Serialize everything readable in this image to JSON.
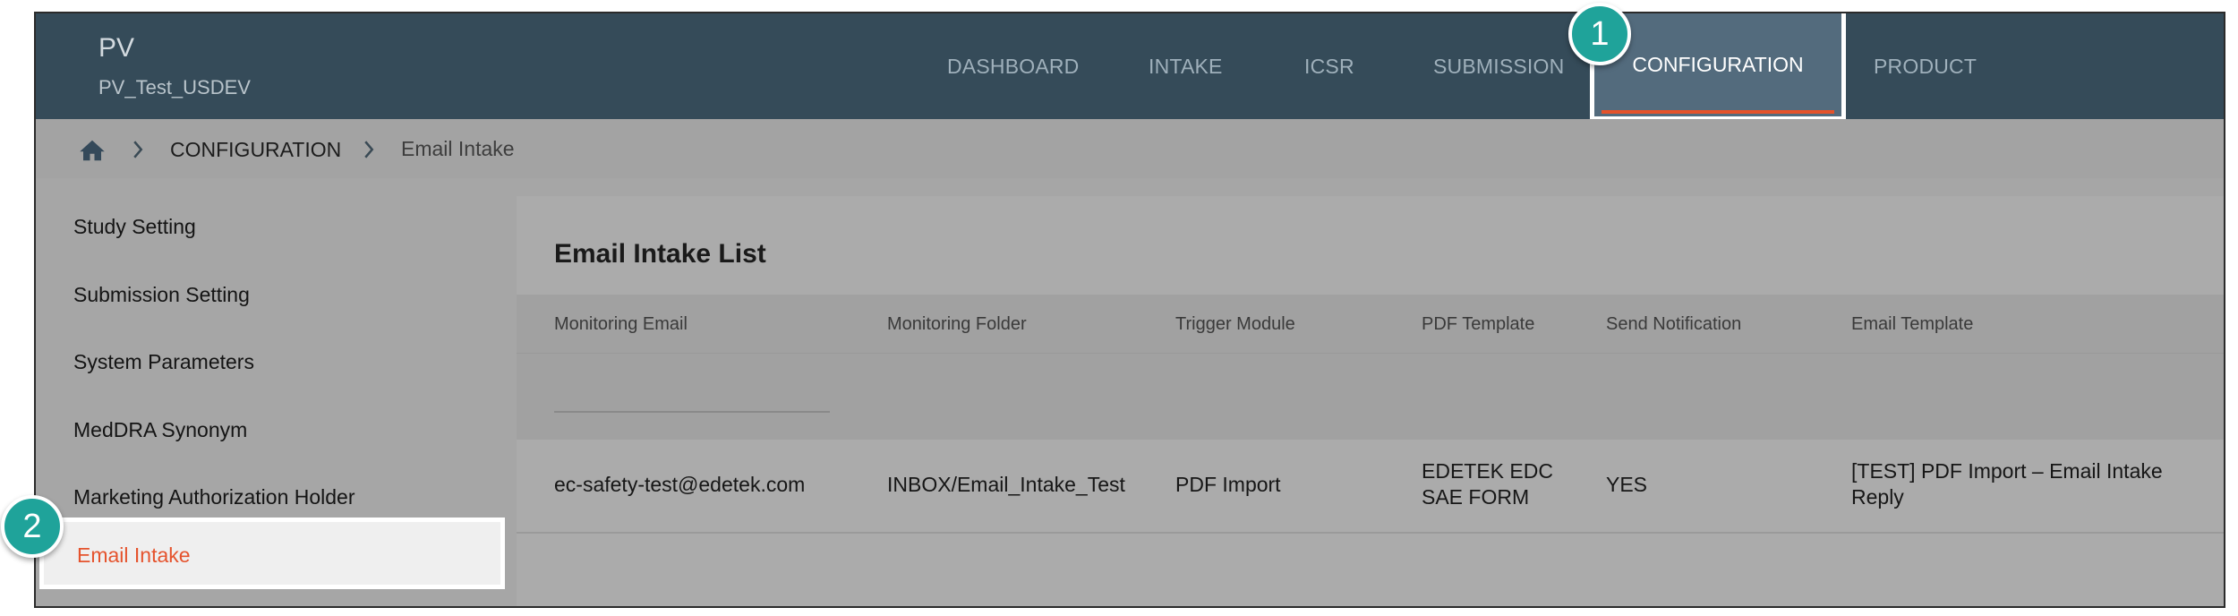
{
  "header": {
    "app_title": "PV",
    "app_subtitle": "PV_Test_USDEV",
    "nav": [
      "DASHBOARD",
      "INTAKE",
      "ICSR",
      "SUBMISSION",
      "CONFIGURATION",
      "PRODUCT"
    ],
    "active_nav": "CONFIGURATION"
  },
  "breadcrumb": {
    "section": "CONFIGURATION",
    "current": "Email Intake"
  },
  "sidebar": {
    "items": [
      "Study Setting",
      "Submission Setting",
      "System Parameters",
      "MedDRA Synonym",
      "Marketing Authorization Holder",
      "Email Intake"
    ],
    "active": "Email Intake"
  },
  "main": {
    "title": "Email Intake List",
    "columns": [
      "Monitoring Email",
      "Monitoring Folder",
      "Trigger Module",
      "PDF Template",
      "Send Notification",
      "Email Template"
    ],
    "filter_value": "",
    "rows": [
      {
        "monitoring_email": "ec-safety-test@edetek.com",
        "monitoring_folder": "INBOX/Email_Intake_Test",
        "trigger_module": "PDF Import",
        "pdf_template_line1": "EDETEK EDC",
        "pdf_template_line2": "SAE FORM",
        "send_notification": "YES",
        "email_template_line1": "[TEST] PDF Import – Email Intake",
        "email_template_line2": "Reply"
      }
    ]
  },
  "callouts": [
    "1",
    "2"
  ],
  "colors": {
    "header_bg": "#354b59",
    "active_nav_bg": "#536b7d",
    "accent": "#e5532d",
    "callout": "#1fa39a"
  },
  "icons": {
    "home": "home-icon",
    "separator": "chevron-right-icon"
  }
}
